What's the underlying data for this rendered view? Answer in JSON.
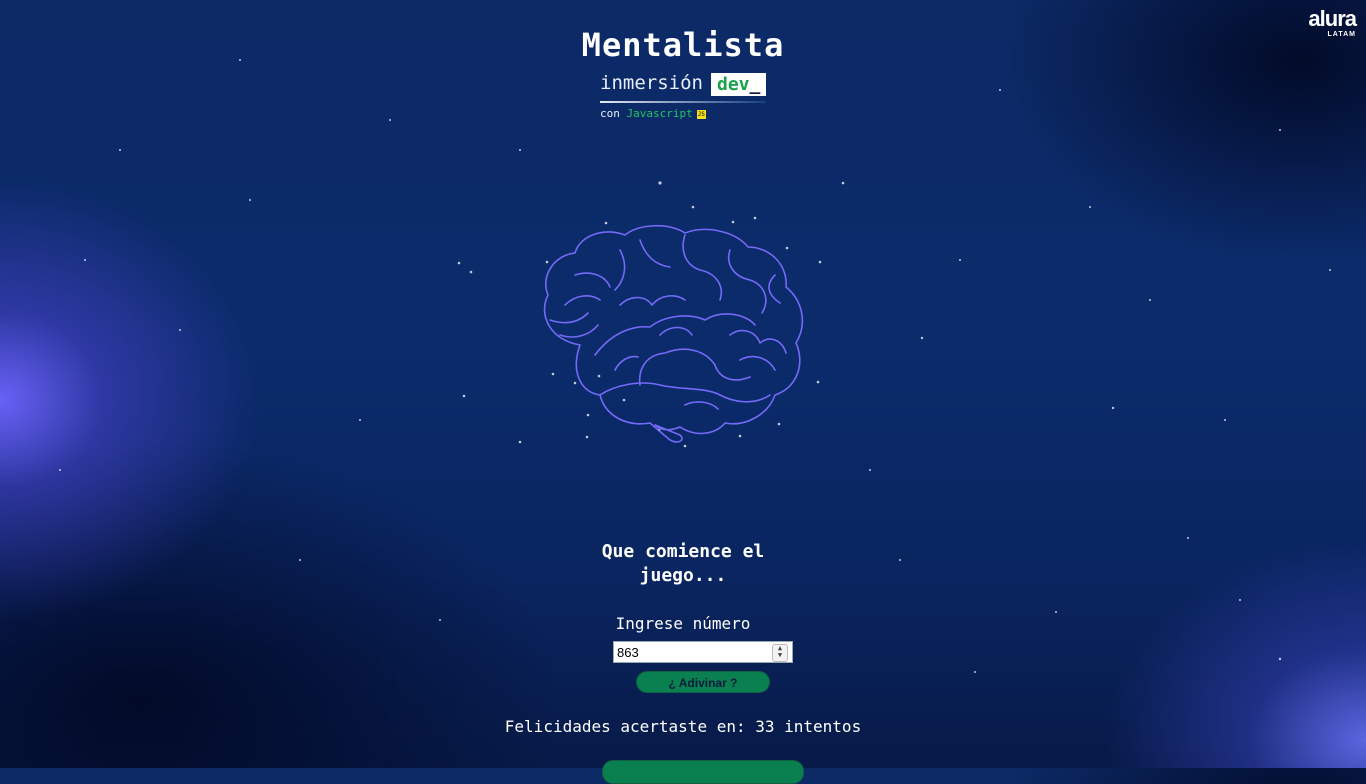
{
  "header": {
    "title": "Mentalista",
    "brand_word": "inmersión",
    "brand_badge": "dev",
    "brand_badge_suffix": "_",
    "subtitle_prefix": "con",
    "subtitle_lang": "Javascript",
    "js_badge": "JS"
  },
  "logo": {
    "word": "alura",
    "sub": "LATAM"
  },
  "game": {
    "heading_line1": "Que comience el",
    "heading_line2": "juego...",
    "input_label": "Ingrese número",
    "input_value": "863",
    "guess_button": "¿ Adivinar ?",
    "result_text": "Felicidades acertaste en: 33 intentos",
    "restart_button": ""
  },
  "colors": {
    "accent_green": "#0a8050",
    "badge_green": "#16a34a",
    "background": "#0b2b6b",
    "brain_stroke": "#7b6dff"
  }
}
